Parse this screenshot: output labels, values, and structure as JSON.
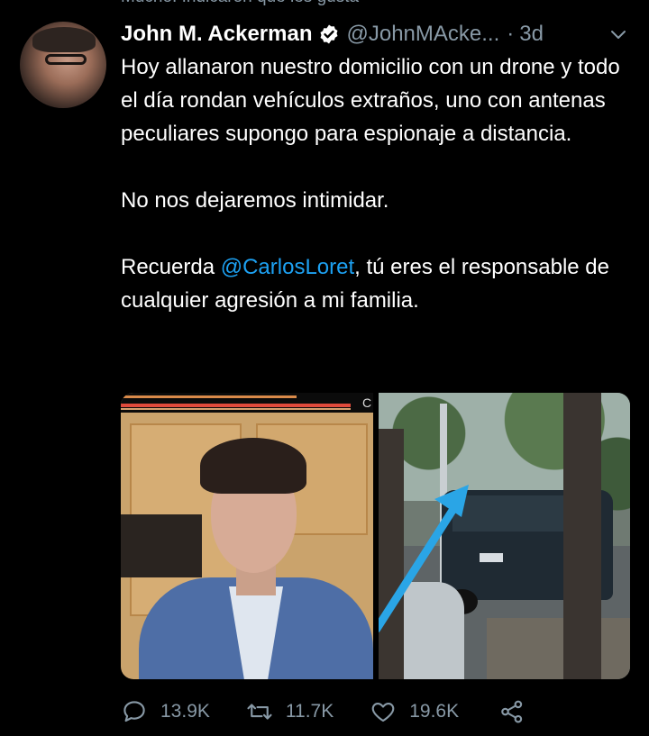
{
  "top_partial_text": "Mucho. Indicaron que les gusta",
  "tweet": {
    "author_name": "John M. Ackerman",
    "handle": "@JohnMAcke...",
    "separator": "·",
    "time": "3d",
    "paragraph1": "Hoy allanaron nuestro domicilio con un drone y todo el día rondan vehículos extraños, uno con antenas peculiares supongo para espionaje a distancia.",
    "paragraph2": "No nos dejaremos intimidar.",
    "paragraph3_before": "Recuerda ",
    "paragraph3_mention": "@CarlosLoret",
    "paragraph3_after": ", tú eres el responsable de cualquier agresión a mi familia.",
    "media_left_glyph": "C"
  },
  "actions": {
    "replies": "13.9K",
    "retweets": "11.7K",
    "likes": "19.6K"
  },
  "icons": {
    "verified": "verified-badge-icon",
    "menu": "chevron-down-icon",
    "reply": "reply-icon",
    "retweet": "retweet-icon",
    "like": "heart-icon",
    "share": "share-icon"
  },
  "colors": {
    "background": "#000000",
    "text": "#ffffff",
    "muted": "#8899a6",
    "link": "#1da1f2"
  }
}
